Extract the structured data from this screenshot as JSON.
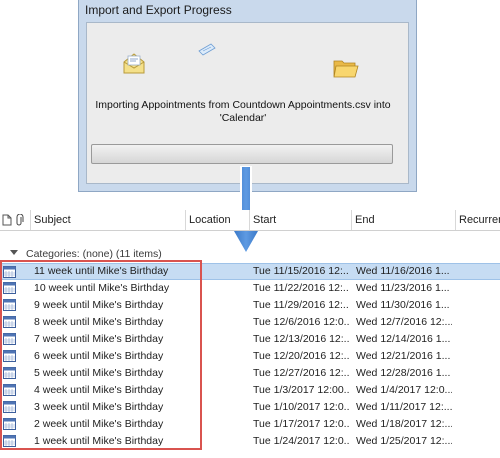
{
  "dialog": {
    "title": "Import and Export Progress",
    "status_line1": "Importing Appointments from Countdown Appointments.csv into",
    "status_line2": "'Calendar'",
    "progress": 0
  },
  "columns": {
    "subject": "Subject",
    "location": "Location",
    "start": "Start",
    "end": "End",
    "recurrence": "Recurren"
  },
  "group_label": "Categories: (none) (11 items)",
  "rows": [
    {
      "subject": "11 week until Mike's Birthday",
      "start": "Tue 11/15/2016 12:...",
      "end": "Wed 11/16/2016 1..."
    },
    {
      "subject": "10 week until Mike's Birthday",
      "start": "Tue 11/22/2016 12:...",
      "end": "Wed 11/23/2016 1..."
    },
    {
      "subject": "9 week until Mike's Birthday",
      "start": "Tue 11/29/2016 12:...",
      "end": "Wed 11/30/2016 1..."
    },
    {
      "subject": "8 week until Mike's Birthday",
      "start": "Tue 12/6/2016 12:0...",
      "end": "Wed 12/7/2016 12:..."
    },
    {
      "subject": "7 week until Mike's Birthday",
      "start": "Tue 12/13/2016 12:...",
      "end": "Wed 12/14/2016 1..."
    },
    {
      "subject": "6 week until Mike's Birthday",
      "start": "Tue 12/20/2016 12:...",
      "end": "Wed 12/21/2016 1..."
    },
    {
      "subject": "5 week until Mike's Birthday",
      "start": "Tue 12/27/2016 12:...",
      "end": "Wed 12/28/2016 1..."
    },
    {
      "subject": "4 week until Mike's Birthday",
      "start": "Tue 1/3/2017 12:00...",
      "end": "Wed 1/4/2017 12:0..."
    },
    {
      "subject": "3 week until Mike's Birthday",
      "start": "Tue 1/10/2017 12:0...",
      "end": "Wed 1/11/2017 12:..."
    },
    {
      "subject": "2 week until Mike's Birthday",
      "start": "Tue 1/17/2017 12:0...",
      "end": "Wed 1/18/2017 12:..."
    },
    {
      "subject": "1 week until Mike's Birthday",
      "start": "Tue 1/24/2017 12:0...",
      "end": "Wed 1/25/2017 12:..."
    }
  ],
  "icons": {
    "envelope": "envelope-icon",
    "flying_page": "flying-page-icon",
    "folder": "folder-icon",
    "document": "document-icon",
    "attachment": "paperclip-icon",
    "calendar": "calendar-icon"
  },
  "colors": {
    "selection": "#c6dcf3",
    "highlight_border": "#d9534f",
    "arrow": "#3f7fcf"
  }
}
